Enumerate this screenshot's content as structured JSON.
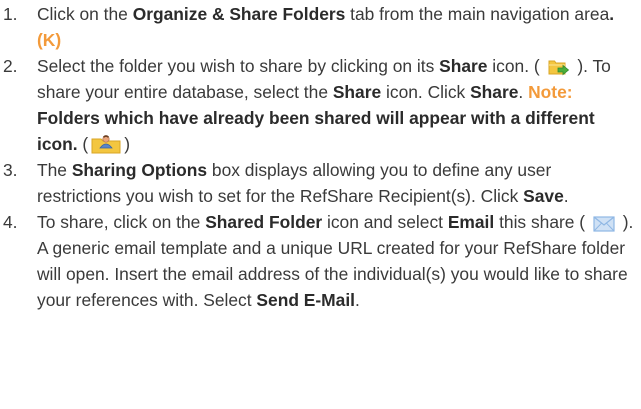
{
  "steps": [
    {
      "number": "1.",
      "t1": "Click on the ",
      "b1": "Organize & Share Folders",
      "t2": " tab from the main navigation area",
      "dot": ".",
      "key": "(K)"
    },
    {
      "number": "2.",
      "t1": "Select the folder you wish to share by clicking on its ",
      "b1": "Share",
      "t2": " icon. ( ",
      "icon1": "folder-share-icon",
      "t3": " ). To share your entire database, select the ",
      "b2": "Share",
      "t4": " icon. Click ",
      "b3": "Share",
      "t5": ". ",
      "note_label": "Note:",
      "note_text": " Folders which have already been shared will appear with a different icon.",
      "t6": " (",
      "icon2": "shared-folder-icon",
      "t7": ")"
    },
    {
      "number": "3.",
      "t1": "The ",
      "b1": "Sharing Options",
      "t2": " box displays allowing you to define any user restrictions you wish to set for the RefShare Recipient(s). Click ",
      "b2": "Save",
      "t3": "."
    },
    {
      "number": "4.",
      "t1": "To share, click on the ",
      "b1": "Shared Folder",
      "t2": " icon and select ",
      "b2": "Email",
      "t3": " this share ( ",
      "icon1": "envelope-icon",
      "t4": " ). A generic email template and a unique URL created for your RefShare folder will open. Insert the email address of the individual(s) you would like to share your references with. Select ",
      "b3": "Send E-Mail",
      "t5": "."
    }
  ],
  "colors": {
    "text": "#3a3a3a",
    "accent_orange": "#f39a3a",
    "folder_yellow": "#f3c640",
    "share_green": "#4cae3b",
    "envelope_blue": "#8fb7e4"
  }
}
